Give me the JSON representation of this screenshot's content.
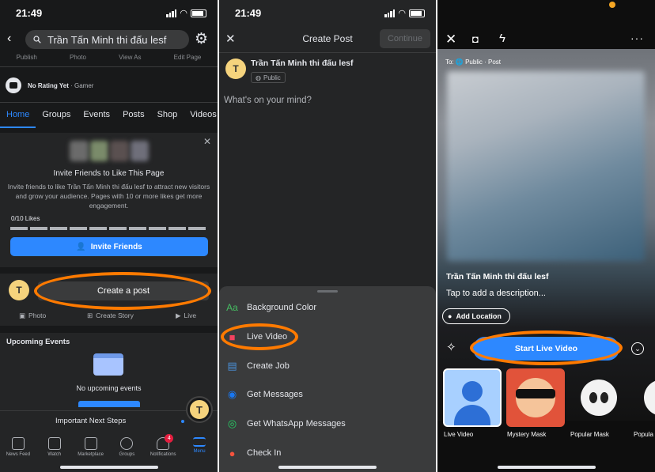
{
  "left": {
    "time": "21:49",
    "search_text": "Trần Tấn Minh thi đấu lesf",
    "top_links": [
      "Publish",
      "Photo",
      "View As",
      "Edit Page"
    ],
    "rating": "No Rating Yet",
    "category": "· Gamer",
    "tabs": [
      "Home",
      "Groups",
      "Events",
      "Posts",
      "Shop",
      "Videos"
    ],
    "invite_title": "Invite Friends to Like This Page",
    "invite_desc": "Invite friends to like Trần Tấn Minh thi đấu lesf to attract new visitors and grow your audience. Pages with 10 or more likes get more engagement.",
    "likes_count": "0/10 Likes",
    "invite_button": "Invite Friends",
    "avatar_letter": "T",
    "create_post": "Create a post",
    "post_actions": [
      "Photo",
      "Create Story",
      "Live"
    ],
    "upcoming_title": "Upcoming Events",
    "no_events": "No upcoming events",
    "important_steps": "Important Next Steps",
    "bottom_nav": [
      "News Feed",
      "Watch",
      "Marketplace",
      "Groups",
      "Notifications",
      "Menu"
    ],
    "notif_count": "4"
  },
  "middle": {
    "time": "21:49",
    "title": "Create Post",
    "continue": "Continue",
    "page_name": "Trần Tấn Minh thi đấu lesf",
    "privacy": "Public",
    "avatar_letter": "T",
    "placeholder": "What's on your mind?",
    "menu": [
      "Background Color",
      "Live Video",
      "Create Job",
      "Get Messages",
      "Get WhatsApp Messages",
      "Check In"
    ]
  },
  "right": {
    "audience": "To: 🌐 Public · Post",
    "page_name": "Trần Tấn Minh thi đấu lesf",
    "description_placeholder": "Tap to add a description...",
    "add_location": "Add Location",
    "start_live": "Start Live Video",
    "effects": [
      "Live Video",
      "Mystery Mask",
      "Popular Mask",
      "Popula"
    ]
  },
  "colors": {
    "accent": "#2d88ff",
    "highlight": "#ff7a00",
    "dark_bg": "#18191a",
    "card_bg": "#242526"
  }
}
